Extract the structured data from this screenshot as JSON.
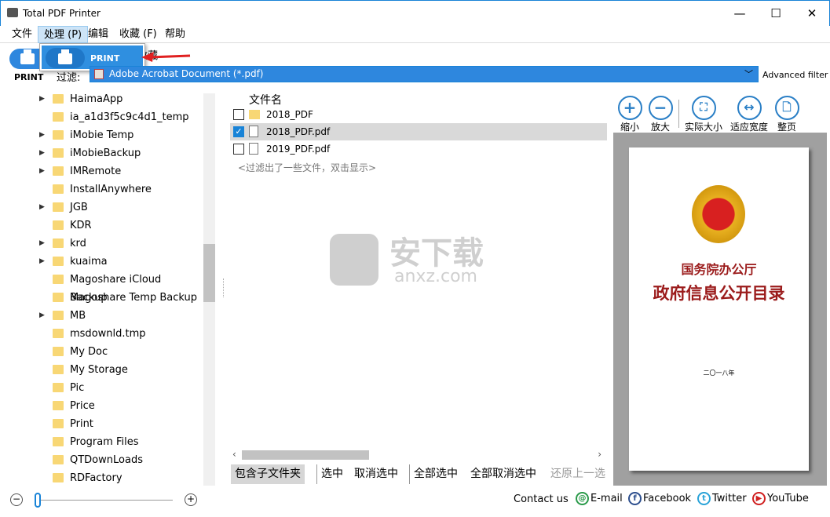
{
  "window": {
    "title": "Total PDF Printer",
    "minimize": "—",
    "maximize": "☐",
    "close": "✕"
  },
  "menu": [
    "文件",
    "处理 (P)",
    "编辑",
    "收藏 (F)",
    "帮助"
  ],
  "popup": {
    "item": "PRINT"
  },
  "toolbar": {
    "print_label": "PRINT",
    "favorites_label": "收藏"
  },
  "filter": {
    "label": "过滤:",
    "value": "Adobe Acrobat Document (*.pdf)",
    "advanced": "Advanced filter"
  },
  "tree": [
    {
      "name": "HaimaApp",
      "exp": true
    },
    {
      "name": "ia_a1d3f5c9c4d1_temp",
      "exp": false
    },
    {
      "name": "iMobie Temp",
      "exp": true
    },
    {
      "name": "iMobieBackup",
      "exp": true
    },
    {
      "name": "IMRemote",
      "exp": true
    },
    {
      "name": "InstallAnywhere",
      "exp": false
    },
    {
      "name": "JGB",
      "exp": true
    },
    {
      "name": "KDR",
      "exp": false
    },
    {
      "name": "krd",
      "exp": true
    },
    {
      "name": "kuaima",
      "exp": true
    },
    {
      "name": "Magoshare iCloud Backup",
      "exp": false
    },
    {
      "name": "Magoshare Temp Backup",
      "exp": false
    },
    {
      "name": "MB",
      "exp": true
    },
    {
      "name": "msdownld.tmp",
      "exp": false
    },
    {
      "name": "My Doc",
      "exp": false
    },
    {
      "name": "My Storage",
      "exp": false
    },
    {
      "name": "Pic",
      "exp": false
    },
    {
      "name": "Price",
      "exp": false
    },
    {
      "name": "Print",
      "exp": false
    },
    {
      "name": "Program Files",
      "exp": false
    },
    {
      "name": "QTDownLoads",
      "exp": false
    },
    {
      "name": "RDFactory",
      "exp": false
    }
  ],
  "files": {
    "header": "文件名",
    "rows": [
      {
        "name": "2018_PDF",
        "type": "folder",
        "checked": false
      },
      {
        "name": "2018_PDF.pdf",
        "type": "pdf",
        "checked": true
      },
      {
        "name": "2019_PDF.pdf",
        "type": "pdf",
        "checked": false
      }
    ],
    "filtered_note": "<过滤出了一些文件，双击显示>"
  },
  "bottom_buttons": [
    "包含子文件夹",
    "选中",
    "取消选中",
    "全部选中",
    "全部取消选中",
    "还原上一选"
  ],
  "preview": {
    "buttons": [
      "缩小",
      "放大",
      "实际大小",
      "适应宽度",
      "整页"
    ],
    "doc": {
      "org": "国务院办公厅",
      "title": "政府信息公开目录",
      "year": "二〇一八年"
    }
  },
  "watermark": {
    "text": "安下载",
    "sub": "anxz.com"
  },
  "footer": {
    "contact": "Contact us",
    "email": "E-mail",
    "facebook": "Facebook",
    "twitter": "Twitter",
    "youtube": "YouTube"
  },
  "zoom_slider": {
    "value": 0
  },
  "colors": {
    "accent": "#1883d7",
    "selection": "#2e87de",
    "doc_red": "#9b1b1b"
  }
}
